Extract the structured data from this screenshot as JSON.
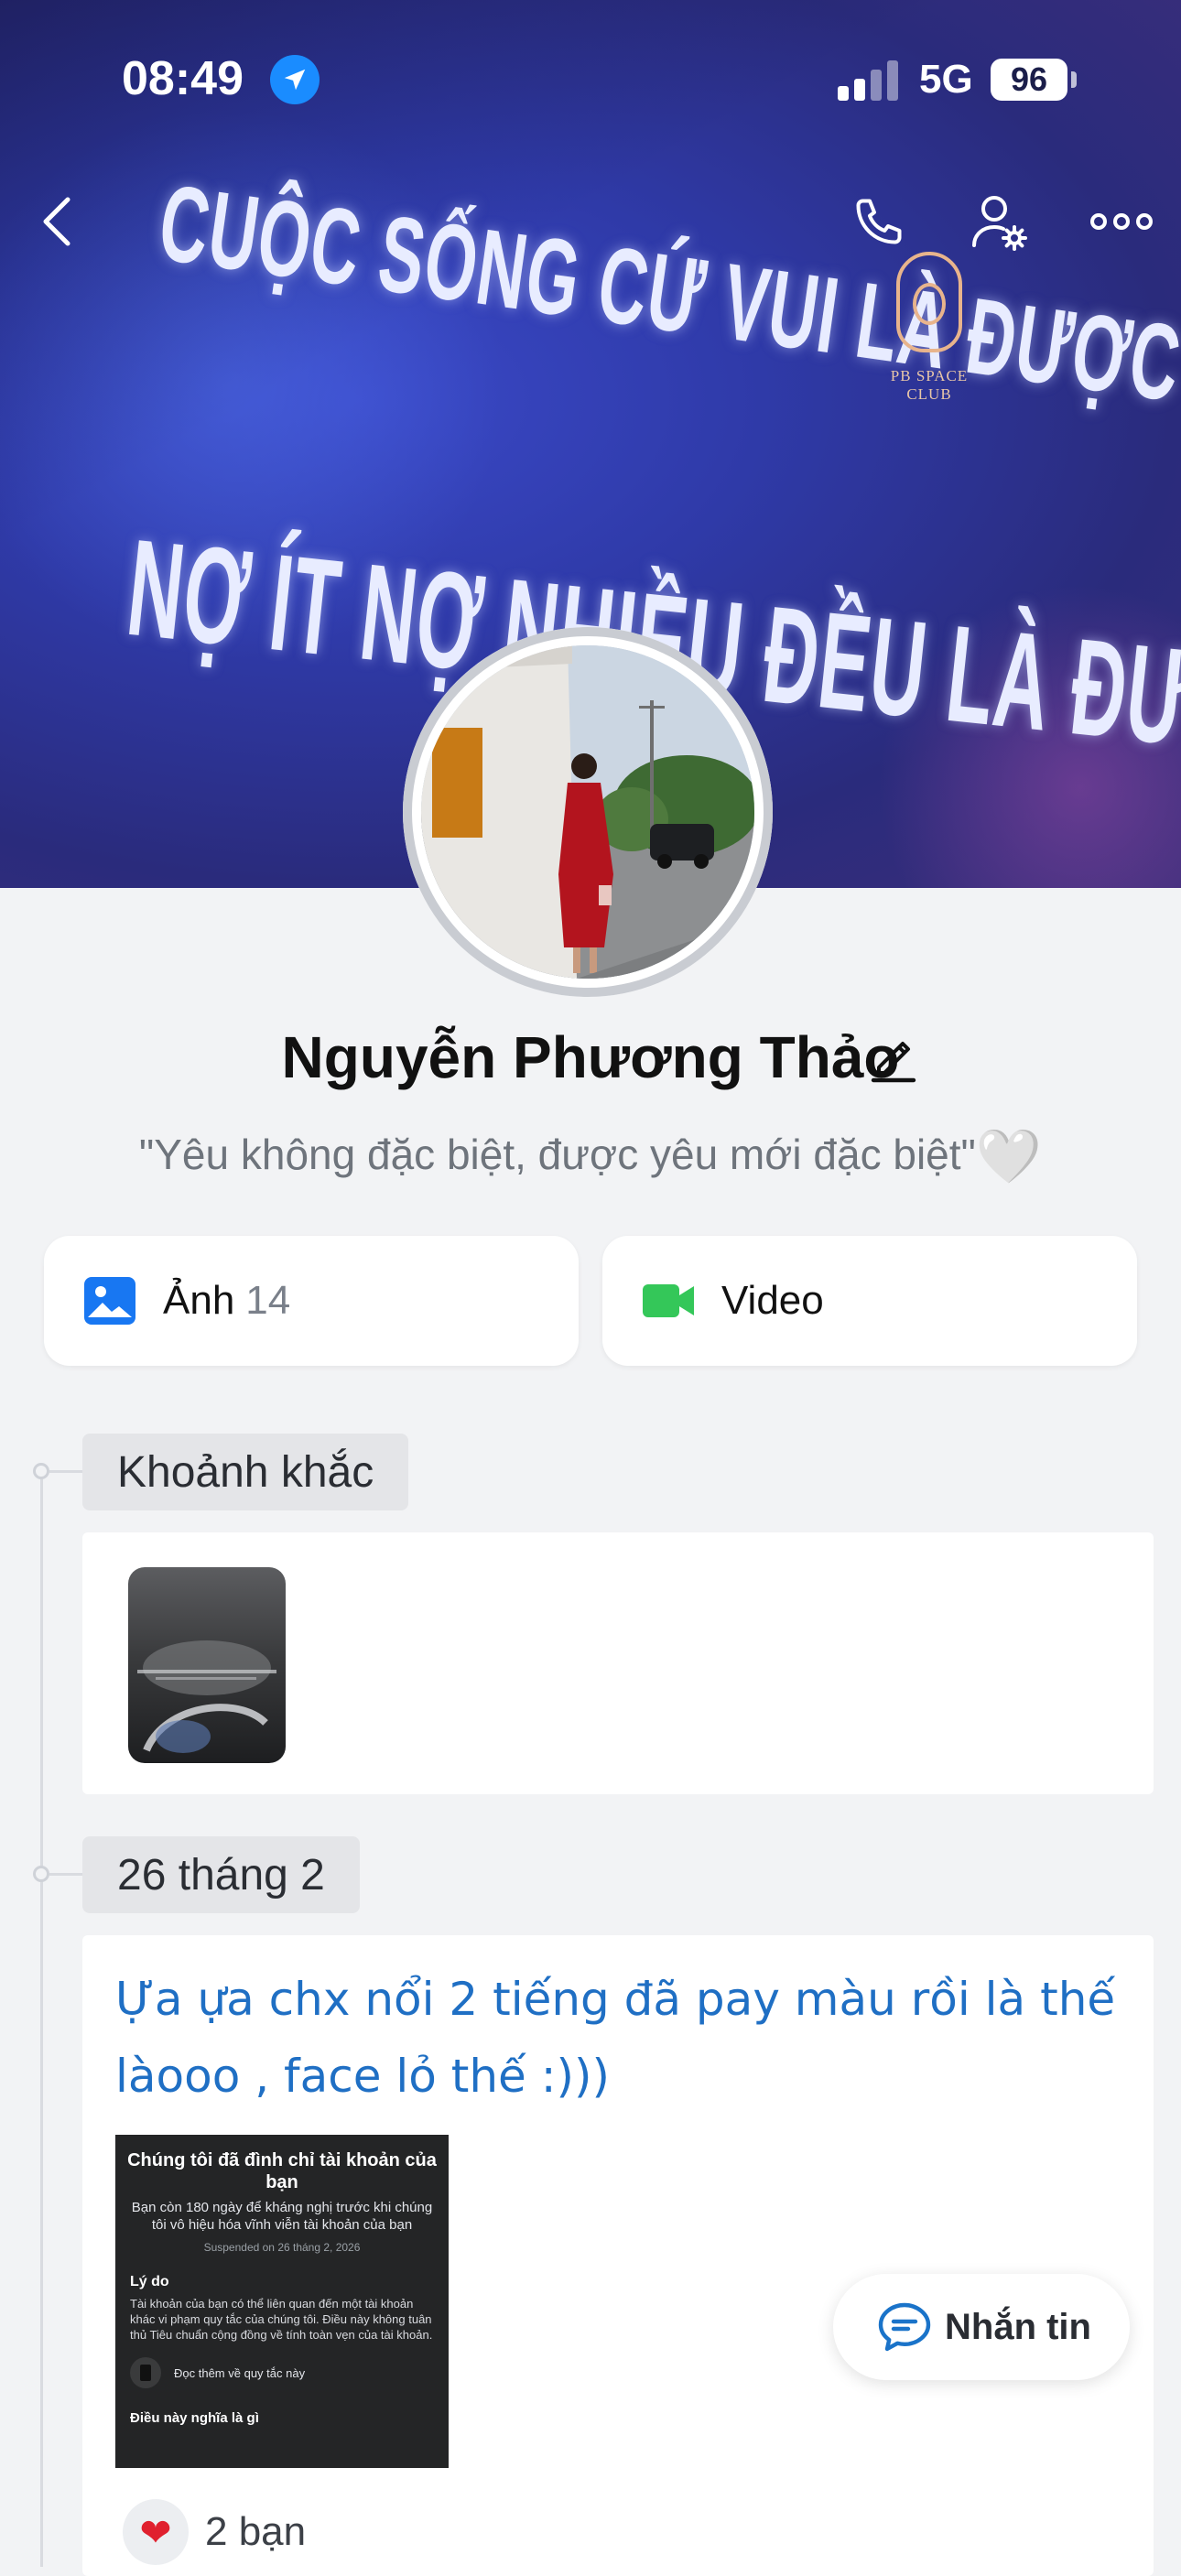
{
  "status_bar": {
    "time": "08:49",
    "network": "5G",
    "battery": "96"
  },
  "cover": {
    "banner_line_1": "CUỘC SỐNG CỨ VUI LÀ ĐƯỢC",
    "banner_line_2": "NỢ ÍT NỢ NHIỀU ĐỀU LÀ ĐƯỢC",
    "club_name": "PB SPACE CLUB"
  },
  "navigation": {
    "icons": [
      "back-icon",
      "call-icon",
      "user-settings-icon",
      "more-icon"
    ]
  },
  "profile": {
    "name": "Nguyễn Phương Thảo",
    "bio": "\"Yêu không đặc biệt, được yêu mới đặc biệt\"",
    "bio_emoji": "🤍"
  },
  "media": {
    "photos_label": "Ảnh",
    "photos_count": "14",
    "video_label": "Video"
  },
  "timeline": {
    "moments_label": "Khoảnh khắc",
    "post_date": "26 tháng 2",
    "post_text": "Ựa ựa chx nổi 2 tiếng đã pay màu rồi là thế làooo , face lỏ thế :)))",
    "screenshot": {
      "title": "Chúng tôi đã đình chỉ tài khoản của bạn",
      "subtitle": "Bạn còn 180 ngày để kháng nghị trước khi chúng tôi vô hiệu hóa vĩnh viễn tài khoản của bạn",
      "suspended_on": "Suspended on 26 tháng 2, 2026",
      "reason_heading": "Lý do",
      "reason_body": "Tài khoản của bạn có thể liên quan đến một tài khoản khác vi phạm quy tắc của chúng tôi. Điều này không tuân thủ Tiêu chuẩn cộng đồng về tính toàn vẹn của tài khoản.",
      "read_more": "Đọc thêm về quy tắc này",
      "next_heading": "Điều này nghĩa là gì"
    },
    "reaction_emoji": "❤",
    "reaction_count": "2 bạn"
  },
  "message_button": {
    "label": "Nhắn tin"
  },
  "colors": {
    "accent": "#1f6fc4",
    "photo_icon": "#1877f2",
    "video_icon": "#34c759",
    "heart": "#e0202e"
  }
}
